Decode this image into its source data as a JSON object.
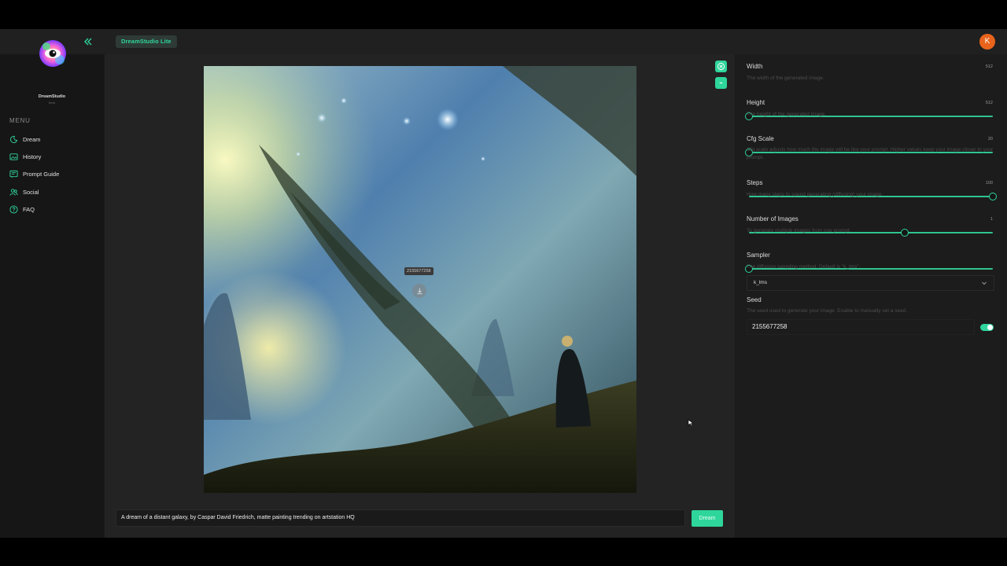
{
  "app": {
    "brand_badge": "DreamStudio Lite",
    "avatar_initial": "K"
  },
  "sidebar": {
    "logo_name": "DreamStudio",
    "logo_sub": "Beta",
    "menu_title": "MENU",
    "items": [
      {
        "label": "Dream",
        "icon": "dream-moon-icon"
      },
      {
        "label": "History",
        "icon": "history-image-icon"
      },
      {
        "label": "Prompt Guide",
        "icon": "prompt-guide-icon"
      },
      {
        "label": "Social",
        "icon": "social-users-icon"
      },
      {
        "label": "FAQ",
        "icon": "faq-question-icon"
      }
    ]
  },
  "main": {
    "image_seed_label": "2155677258",
    "prompt": "A dream of a distant galaxy, by Caspar David Friedrich, matte painting trending on artstation HQ",
    "dream_button": "Dream"
  },
  "settings": {
    "width": {
      "label": "Width",
      "desc": "The width of the generated image.",
      "value": "512",
      "level": 0.0
    },
    "height": {
      "label": "Height",
      "desc": "The height of the generated image.",
      "value": "512",
      "level": 0.0
    },
    "cfg": {
      "label": "Cfg Scale",
      "desc": "Cfg scale adjusts how much the image will be like your prompt. Higher values keep your image closer to your prompt.",
      "value": "20",
      "level": 1.0
    },
    "steps": {
      "label": "Steps",
      "desc": "How many steps to spend generating (diffusing) your image.",
      "value": "100",
      "level": 0.64
    },
    "num_images": {
      "label": "Number of Images",
      "desc": "To generate multiple images from one prompt.",
      "value": "1",
      "level": 0.0
    },
    "sampler": {
      "label": "Sampler",
      "desc": "The diffusion sampling method. Default is \"k_lms\".",
      "value": "k_lms"
    },
    "seed": {
      "label": "Seed",
      "desc": "The seed used to generate your image. Enable to manually set a seed.",
      "value": "2155677258",
      "enabled": true
    }
  },
  "colors": {
    "accent": "#2fd69c",
    "avatar": "#e8641c"
  }
}
